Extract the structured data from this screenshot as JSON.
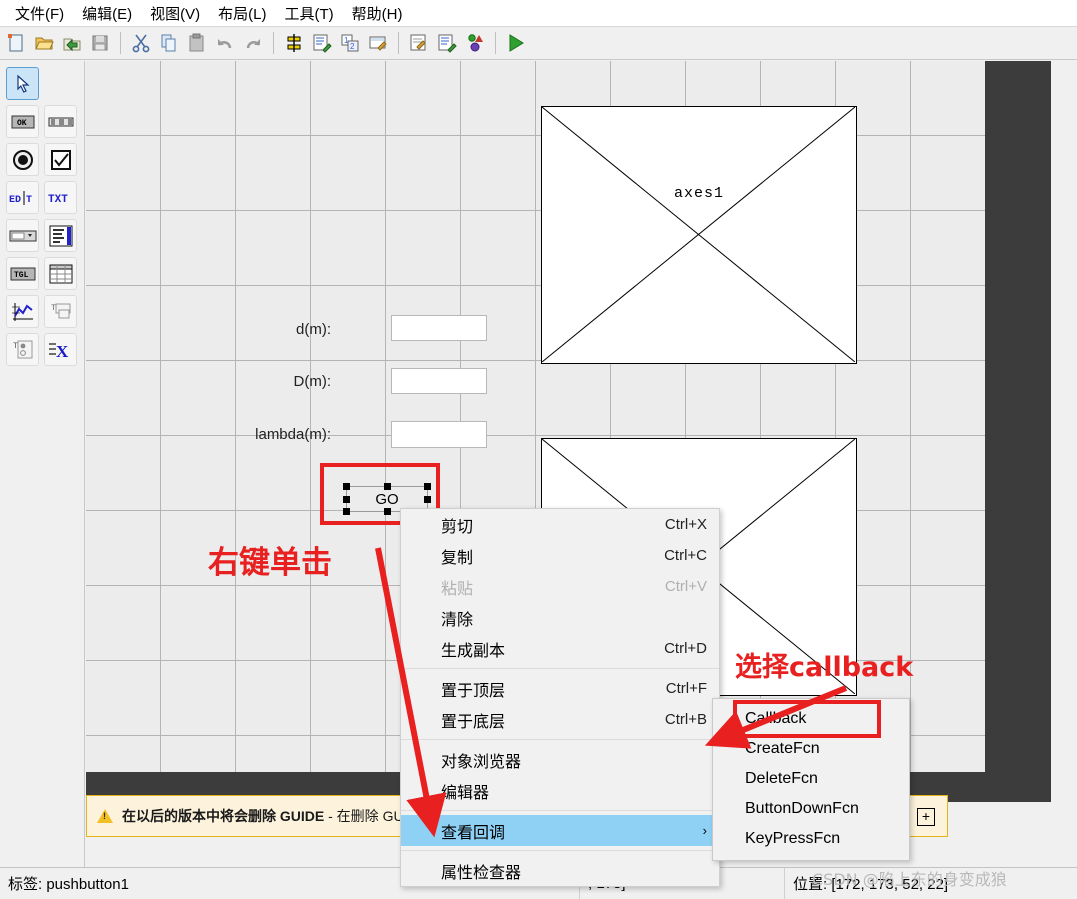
{
  "menubar": {
    "items": [
      {
        "label": "文件(F)",
        "name": "menu-file"
      },
      {
        "label": "编辑(E)",
        "name": "menu-edit"
      },
      {
        "label": "视图(V)",
        "name": "menu-view"
      },
      {
        "label": "布局(L)",
        "name": "menu-layout"
      },
      {
        "label": "工具(T)",
        "name": "menu-tools"
      },
      {
        "label": "帮助(H)",
        "name": "menu-help"
      }
    ]
  },
  "toolbar": {
    "buttons": [
      {
        "icon": "new-file-icon"
      },
      {
        "icon": "open-folder-icon"
      },
      {
        "icon": "save-as-icon"
      },
      {
        "icon": "save-icon"
      },
      {
        "icon": "cut-icon"
      },
      {
        "icon": "copy-icon"
      },
      {
        "icon": "paste-icon"
      },
      {
        "icon": "undo-icon"
      },
      {
        "icon": "redo-icon"
      },
      {
        "icon": "align-objects-icon"
      },
      {
        "icon": "menu-editor-icon"
      },
      {
        "icon": "tab-order-editor-icon"
      },
      {
        "icon": "toolbar-editor-icon"
      },
      {
        "icon": "m-file-editor-icon"
      },
      {
        "icon": "property-inspector-icon"
      },
      {
        "icon": "object-browser-icon"
      },
      {
        "icon": "run-icon"
      }
    ]
  },
  "palette": {
    "items": [
      {
        "name": "select-tool",
        "icon": "arrow-cursor-icon",
        "label": "",
        "selected": true
      },
      {
        "name": "push-button-tool",
        "icon": "ok-button-icon",
        "label": "OK"
      },
      {
        "name": "slider-tool",
        "icon": "slider-icon",
        "label": ""
      },
      {
        "name": "radio-button-tool",
        "icon": "radio-button-icon",
        "label": ""
      },
      {
        "name": "checkbox-tool",
        "icon": "checkbox-icon",
        "label": ""
      },
      {
        "name": "edit-text-tool",
        "icon": "edit-text-icon",
        "label": "EDIT"
      },
      {
        "name": "static-text-tool",
        "icon": "static-text-icon",
        "label": "TXT"
      },
      {
        "name": "popup-menu-tool",
        "icon": "popup-menu-icon",
        "label": ""
      },
      {
        "name": "listbox-tool",
        "icon": "listbox-icon",
        "label": ""
      },
      {
        "name": "toggle-button-tool",
        "icon": "toggle-button-icon",
        "label": "TGL"
      },
      {
        "name": "table-tool",
        "icon": "table-icon",
        "label": ""
      },
      {
        "name": "axes-tool",
        "icon": "axes-plot-icon",
        "label": ""
      },
      {
        "name": "panel-tool",
        "icon": "panel-icon",
        "label": ""
      },
      {
        "name": "button-group-tool",
        "icon": "button-group-icon",
        "label": ""
      },
      {
        "name": "activex-tool",
        "icon": "activex-icon",
        "label": "X"
      }
    ]
  },
  "canvas": {
    "axes": [
      {
        "label": "axes1",
        "name": "axes1-component"
      },
      {
        "label": "",
        "name": "axes2-component"
      }
    ],
    "labels": [
      {
        "text": "d(m):",
        "name": "label-d"
      },
      {
        "text": "D(m):",
        "name": "label-big-d"
      },
      {
        "text": "lambda(m):",
        "name": "label-lambda"
      }
    ],
    "edit_fields": [
      {
        "value": "",
        "name": "edit-d"
      },
      {
        "value": "",
        "name": "edit-big-d"
      },
      {
        "value": "",
        "name": "edit-lambda"
      }
    ],
    "go_button": {
      "label": "GO",
      "name": "go-pushbutton"
    }
  },
  "context_menu": {
    "items": [
      {
        "label": "剪切",
        "accel": "Ctrl+X",
        "disabled": false,
        "highlight": false,
        "submenu": false,
        "name": "ctx-cut"
      },
      {
        "label": "复制",
        "accel": "Ctrl+C",
        "disabled": false,
        "highlight": false,
        "submenu": false,
        "name": "ctx-copy"
      },
      {
        "label": "粘贴",
        "accel": "Ctrl+V",
        "disabled": true,
        "highlight": false,
        "submenu": false,
        "name": "ctx-paste"
      },
      {
        "label": "清除",
        "accel": "",
        "disabled": false,
        "highlight": false,
        "submenu": false,
        "name": "ctx-clear"
      },
      {
        "label": "生成副本",
        "accel": "Ctrl+D",
        "disabled": false,
        "highlight": false,
        "submenu": false,
        "name": "ctx-duplicate"
      },
      {
        "separator": true
      },
      {
        "label": "置于顶层",
        "accel": "Ctrl+F",
        "disabled": false,
        "highlight": false,
        "submenu": false,
        "name": "ctx-bring-to-front"
      },
      {
        "label": "置于底层",
        "accel": "Ctrl+B",
        "disabled": false,
        "highlight": false,
        "submenu": false,
        "name": "ctx-send-to-back"
      },
      {
        "separator": true
      },
      {
        "label": "对象浏览器",
        "accel": "",
        "disabled": false,
        "highlight": false,
        "submenu": false,
        "name": "ctx-object-browser"
      },
      {
        "label": "编辑器",
        "accel": "",
        "disabled": false,
        "highlight": false,
        "submenu": false,
        "name": "ctx-editor"
      },
      {
        "separator": true
      },
      {
        "label": "查看回调",
        "accel": "",
        "disabled": false,
        "highlight": true,
        "submenu": true,
        "arrow": "›",
        "name": "ctx-view-callbacks"
      },
      {
        "separator": true
      },
      {
        "label": "属性检查器",
        "accel": "",
        "disabled": false,
        "highlight": false,
        "submenu": false,
        "name": "ctx-property-inspector"
      }
    ]
  },
  "submenu": {
    "items": [
      {
        "label": "Callback",
        "name": "submenu-callback"
      },
      {
        "label": "CreateFcn",
        "name": "submenu-createfcn"
      },
      {
        "label": "DeleteFcn",
        "name": "submenu-deletefcn"
      },
      {
        "label": "ButtonDownFcn",
        "name": "submenu-buttondownfcn"
      },
      {
        "label": "KeyPressFcn",
        "name": "submenu-keypressfcn"
      }
    ]
  },
  "warning": {
    "text_bold": "在以后的版本中将会删除 GUIDE",
    "text_rest": " - 在删除 GUIDE ",
    "expand_label": "+"
  },
  "statusbar": {
    "tag": "标签: pushbutton1",
    "size": ", 178]",
    "position": "位置: [172, 173, 52, 22]"
  },
  "annotations": {
    "right_click": "右键单击",
    "select_callback": "选择callback"
  },
  "watermark": "CSDN @陷上东的身变成狼",
  "colors": {
    "accent_red": "#e8201f",
    "highlight_blue": "#8fd0f5",
    "warning_bg": "#fdf3dc",
    "warning_border": "#e6b319",
    "dark_band": "#3c3c3c"
  }
}
